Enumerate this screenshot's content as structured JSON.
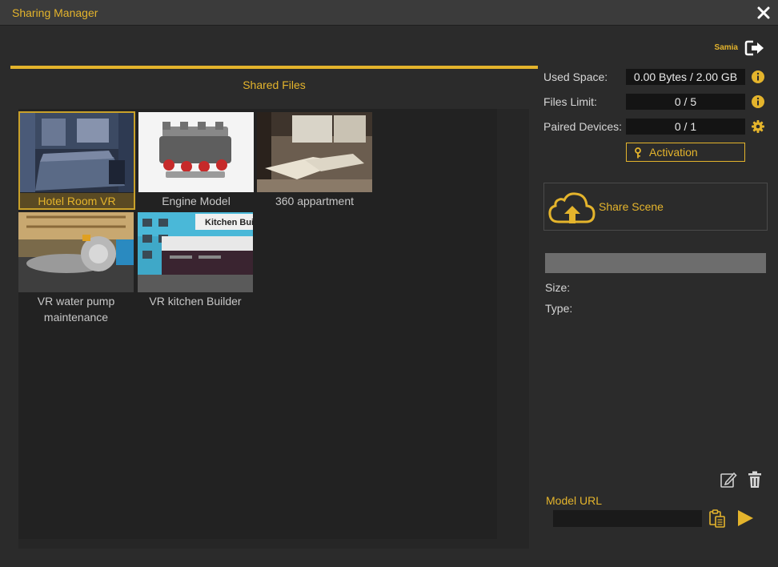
{
  "window": {
    "title": "Sharing Manager"
  },
  "user": {
    "name": "Samia"
  },
  "tabs": {
    "shared_files": "Shared Files"
  },
  "files": [
    {
      "name": "Hotel Room VR",
      "selected": true
    },
    {
      "name": "Engine Model",
      "selected": false
    },
    {
      "name": "360 appartment",
      "selected": false
    },
    {
      "name": "VR water pump maintenance",
      "selected": false
    },
    {
      "name": "VR kitchen Builder",
      "selected": false
    }
  ],
  "thumbnail_text": {
    "kitchen": "Kitchen Buil"
  },
  "stats": {
    "used_space_label": "Used Space:",
    "used_space_value": "0.00 Bytes / 2.00 GB",
    "files_limit_label": "Files Limit:",
    "files_limit_value": "0 / 5",
    "paired_devices_label": "Paired Devices:",
    "paired_devices_value": "0 / 1"
  },
  "actions": {
    "activation_label": "Activation",
    "share_scene_label": "Share Scene"
  },
  "details": {
    "size_label": "Size:",
    "type_label": "Type:"
  },
  "model_url": {
    "label": "Model URL",
    "value": ""
  },
  "colors": {
    "accent": "#e4b42c",
    "background": "#2b2b2b",
    "panel": "#222222",
    "titlebar": "#3b3b3b"
  },
  "icons": {
    "close": "close-icon",
    "logout": "logout-icon",
    "info": "info-icon",
    "settings": "gear-icon",
    "key": "key-icon",
    "cloud_upload": "cloud-upload-icon",
    "edit": "edit-icon",
    "delete": "trash-icon",
    "copy": "clipboard-icon",
    "play": "play-icon"
  }
}
